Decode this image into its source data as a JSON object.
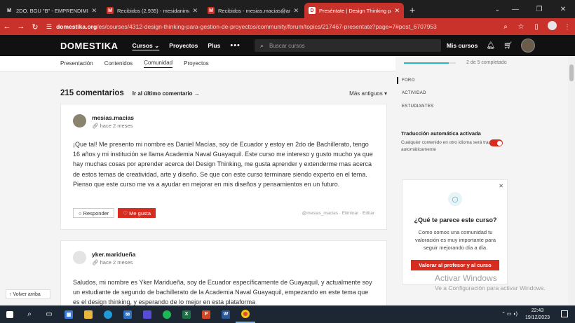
{
  "browser": {
    "tabs": [
      {
        "title": "2DO. BGU \"B\" - EMPRENDIMIENTO",
        "favicon": "M",
        "color": "#222222",
        "active": false
      },
      {
        "title": "Recibidos (2,935) - mesidanimar",
        "favicon": "M",
        "color": "#d93025",
        "active": false
      },
      {
        "title": "Recibidos - mesias.macias@ang",
        "favicon": "M",
        "color": "#d93025",
        "active": false
      },
      {
        "title": "Preséntate | Design Thinking pa",
        "favicon": "D",
        "color": "#c9312b",
        "active": true
      }
    ],
    "url_domain": "domestika.org",
    "url_path": "/es/courses/4312-design-thinking-para-gestion-de-proyectos/community/forum/topics/217467-presentate?page=7#post_6707953"
  },
  "site": {
    "logo": "DOMESTIKA",
    "nav": [
      "Cursos",
      "Proyectos",
      "Plus"
    ],
    "cursos_caret": "⌄",
    "more": "•••",
    "search_placeholder": "Buscar cursos",
    "my_courses": "Mis cursos"
  },
  "subnav": {
    "items": [
      "Presentación",
      "Contenidos",
      "Comunidad",
      "Proyectos"
    ],
    "active": "Comunidad"
  },
  "comments": {
    "count": "215 comentarios",
    "last_link": "Ir al último comentario →",
    "sort": "Más antiguos ▾",
    "list": [
      {
        "user": "mesias.macias",
        "time": "hace 2 meses",
        "text": "¡Que tal! Me presento mi nombre es Daniel Macías, soy de Ecuador y estoy en 2do de Bachillerato, tengo 16 años y mi institución se llama Academia Naval Guayaquil. Este curso me intereso y gusto mucho ya que hay muchas cosas por aprender acerca del Design Thinking, me gusta aprender y extenderme mas acerca de estos temas de creatividad, arte y diseño. Se que con este curso terminare siendo experto en el tema. Pienso que este curso me va a ayudar en mejorar en mis diseños y pensamientos en un futuro.",
        "reply": "Responder",
        "like": "Me gusta",
        "meta": "@mesias_macias  ·  Eliminar  ·  Editar"
      },
      {
        "user": "yker.maridueña",
        "time": "hace 2 meses",
        "text": "Saludos, mi nombre es Yker Maridueña, soy de Ecuador específicamente de Guayaquil, y actualmente soy un estudiante de segundo de bachillerato de la Academia Naval Guayaquil, empezando en este tema que es el design thinking, y esperando de lo mejor en esta plataforma"
      }
    ]
  },
  "back_to_top": "↑ Volver arriba",
  "sidebar": {
    "progress_text": "2 de 5 completado",
    "progress_fraction": 0.4,
    "items": [
      "FORO",
      "ACTIVIDAD",
      "ESTUDIANTES"
    ],
    "translate_title": "Traducción automática activada",
    "translate_desc": "Cualquier contenido en otro idioma será traducido automáticamente",
    "translate_on": true,
    "feedback_title": "¿Qué te parece este curso?",
    "feedback_desc": "Como somos una comunidad tu valoración es muy importante para seguir mejorando día a día.",
    "feedback_button": "Valorar al profesor y al curso"
  },
  "watermark": {
    "line1": "Activar Windows",
    "line2": "Ve a Configuración para activar Windows."
  },
  "taskbar": {
    "time": "22:43",
    "date": "19/12/2023",
    "accent": "#7fb3e0"
  },
  "colors": {
    "brand_red": "#c9312b",
    "like_red": "#d62d20",
    "progress": "#2ab3c0"
  }
}
